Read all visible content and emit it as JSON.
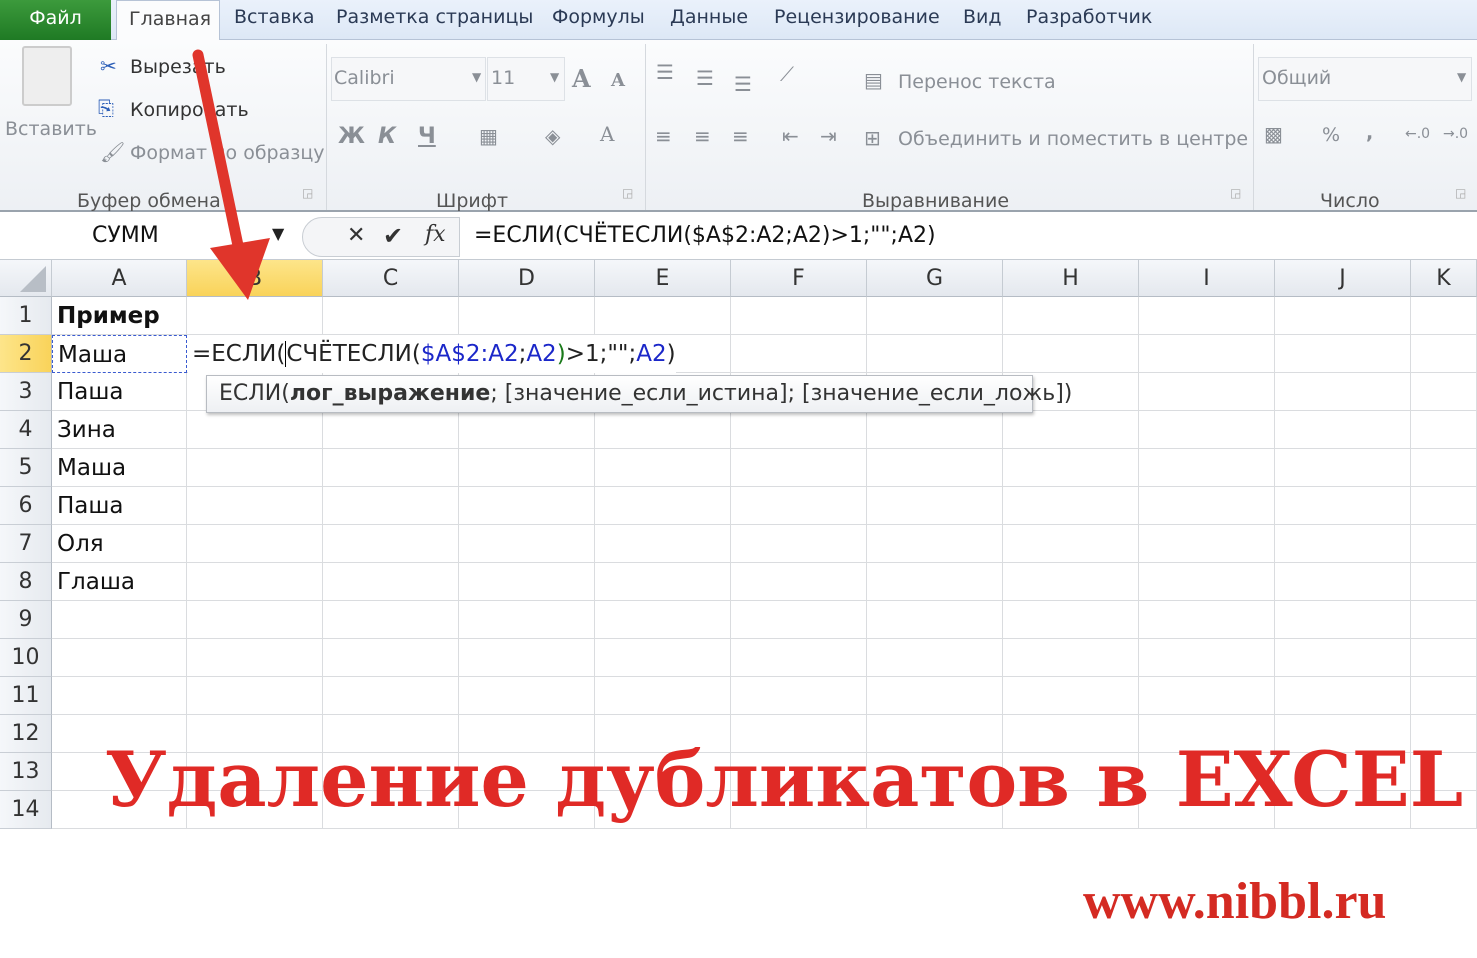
{
  "tabs": {
    "file": "Файл",
    "home": "Главная",
    "others": [
      "Вставка",
      "Разметка страницы",
      "Формулы",
      "Данные",
      "Рецензирование",
      "Вид",
      "Разработчик"
    ]
  },
  "ribbon": {
    "clipboard": {
      "paste": "Вставить",
      "cut": "Вырезать",
      "copy": "Копировать",
      "format_painter": "Формат по образцу",
      "group": "Буфер обмена"
    },
    "font": {
      "name": "Calibri",
      "size": "11",
      "bold": "Ж",
      "italic": "К",
      "underline": "Ч",
      "group": "Шрифт"
    },
    "alignment": {
      "wrap": "Перенос текста",
      "merge": "Объединить и поместить в центре",
      "group": "Выравнивание"
    },
    "number": {
      "format": "Общий",
      "percent": "%",
      "comma": ",",
      "group": "Число"
    }
  },
  "formula_bar": {
    "name_box": "СУММ",
    "formula": "=ЕСЛИ(СЧЁТЕСЛИ($A$2:A2;A2)>1;\"\";A2)"
  },
  "columns": [
    "A",
    "B",
    "C",
    "D",
    "E",
    "F",
    "G",
    "H",
    "I",
    "J",
    "K"
  ],
  "rows": [
    "1",
    "2",
    "3",
    "4",
    "5",
    "6",
    "7",
    "8",
    "9",
    "10",
    "11",
    "12",
    "13",
    "14"
  ],
  "cells_a": [
    "Пример",
    "Маша",
    "Паша",
    "Зина",
    "Маша",
    "Паша",
    "Оля",
    "Глаша"
  ],
  "edit": {
    "p1": "=ЕСЛИ(",
    "p2": "СЧЁТЕСЛИ(",
    "p3": "$A$2:A2",
    ";": ";",
    "p4": "A2",
    "p5": ")",
    "p6": ">1;\"\";",
    "p7": "A2",
    "p8": ")"
  },
  "tooltip": {
    "fn": "ЕСЛИ(",
    "arg1": "лог_выражение",
    "rest": "; [значение_если_истина]; [значение_если_ложь])"
  },
  "overlay": {
    "title": "Удаление дубликатов в EXCEL",
    "site": "www.nibbl.ru"
  },
  "colors": {
    "accent": "#e02a26",
    "selected_header": "#f9d35a",
    "file_tab": "#2a8a2e"
  }
}
